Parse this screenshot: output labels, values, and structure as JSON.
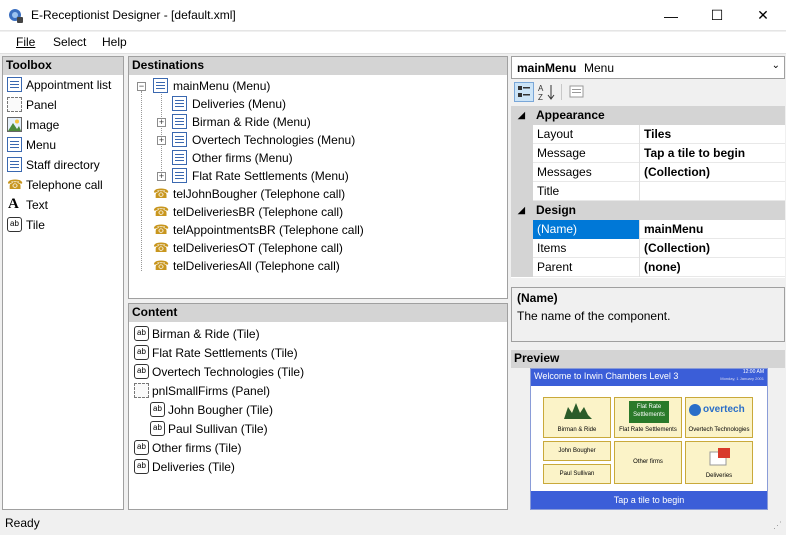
{
  "window": {
    "title": "E-Receptionist Designer - [default.xml]",
    "minimize": "—",
    "maximize": "☐",
    "close": "✕"
  },
  "menu": {
    "file": "File",
    "select": "Select",
    "help": "Help"
  },
  "toolbox": {
    "header": "Toolbox",
    "items": [
      {
        "label": "Appointment list",
        "icon": "appointment-list-icon"
      },
      {
        "label": "Panel",
        "icon": "panel-icon"
      },
      {
        "label": "Image",
        "icon": "image-icon"
      },
      {
        "label": "Menu",
        "icon": "menu-icon"
      },
      {
        "label": "Staff directory",
        "icon": "staff-directory-icon"
      },
      {
        "label": "Telephone call",
        "icon": "telephone-icon"
      },
      {
        "label": "Text",
        "icon": "text-icon"
      },
      {
        "label": "Tile",
        "icon": "tile-icon"
      }
    ]
  },
  "destinations": {
    "header": "Destinations",
    "root": "mainMenu (Menu)",
    "children": [
      "Deliveries (Menu)",
      "Birman & Ride (Menu)",
      "Overtech Technologies (Menu)",
      "Other firms (Menu)",
      "Flat Rate Settlements (Menu)"
    ],
    "calls": [
      "telJohnBougher (Telephone call)",
      "telDeliveriesBR (Telephone call)",
      "telAppointmentsBR (Telephone call)",
      "telDeliveriesOT (Telephone call)",
      "telDeliveriesAll (Telephone call)"
    ]
  },
  "content": {
    "header": "Content",
    "items": [
      "Birman & Ride (Tile)",
      "Flat Rate Settlements (Tile)",
      "Overtech Technologies (Tile)",
      "pnlSmallFirms (Panel)",
      "John Bougher (Tile)",
      "Paul Sullivan (Tile)",
      "Other firms (Tile)",
      "Deliveries (Tile)"
    ]
  },
  "properties": {
    "object_name": "mainMenu",
    "object_type": "Menu",
    "categories": [
      {
        "name": "Appearance",
        "rows": [
          {
            "name": "Layout",
            "value": "Tiles"
          },
          {
            "name": "Message",
            "value": "Tap a tile to begin"
          },
          {
            "name": "Messages",
            "value": "(Collection)"
          },
          {
            "name": "Title",
            "value": ""
          }
        ]
      },
      {
        "name": "Design",
        "rows": [
          {
            "name": "(Name)",
            "value": "mainMenu"
          },
          {
            "name": "Items",
            "value": "(Collection)"
          },
          {
            "name": "Parent",
            "value": "(none)"
          }
        ]
      }
    ],
    "help_title": "(Name)",
    "help_text": "The name of the component."
  },
  "preview": {
    "header": "Preview",
    "banner": "Welcome to Irwin Chambers Level 3",
    "time": "12:00 AM",
    "date": "Monday, 1 January 2001",
    "tiles": [
      "Birman & Ride",
      "Flat Rate Settlements",
      "Overtech Technologies",
      "John Bougher",
      "Paul Sullivan",
      "Other firms",
      "Deliveries"
    ],
    "logo_flat_rate": "Flat Rate Settlements",
    "logo_overtech": "overtech",
    "footer": "Tap a tile to begin",
    "colors": {
      "banner": "#3b5ed8",
      "tile_bg": "#fbf3c8",
      "tile_border": "#c9a93a",
      "footer": "#3b5ed8"
    }
  },
  "status": {
    "text": "Ready"
  }
}
